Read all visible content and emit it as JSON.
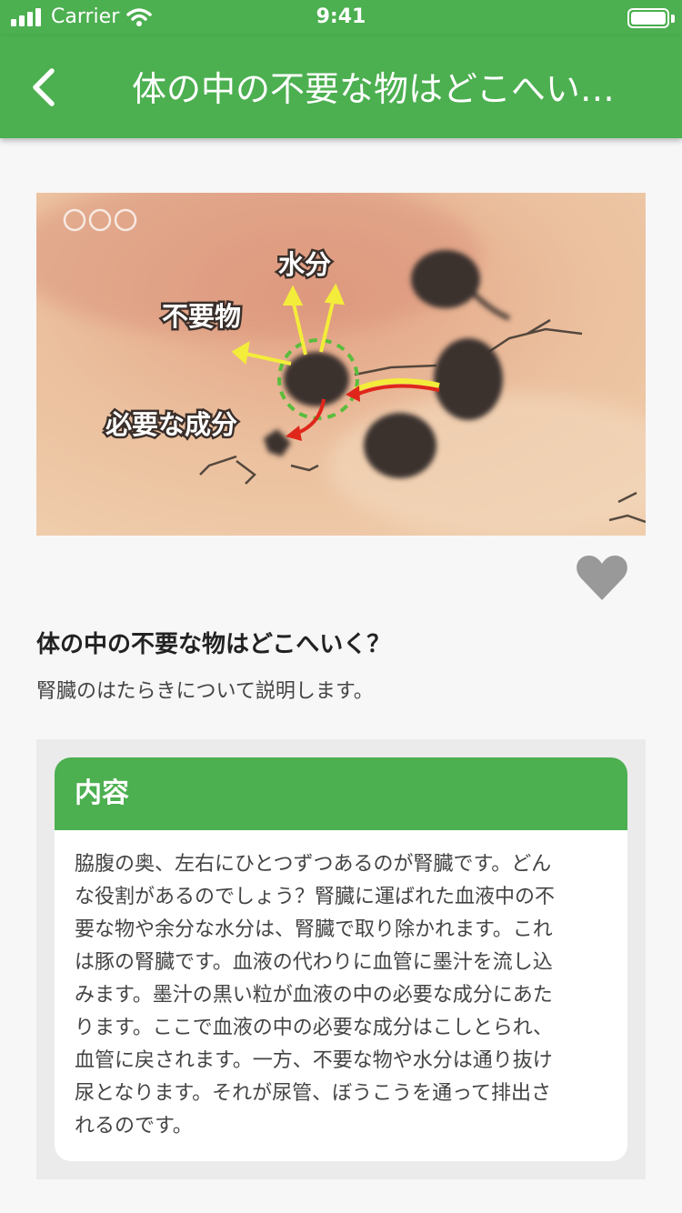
{
  "status_bar": {
    "carrier": "Carrier",
    "time": "9:41"
  },
  "nav": {
    "title": "体の中の不要な物はどこへい…",
    "back_icon": "chevron-left-icon"
  },
  "hero": {
    "labels": {
      "water": "水分",
      "waste": "不要物",
      "needed": "必要な成分"
    }
  },
  "favorite_icon": "heart-icon",
  "item": {
    "title": "体の中の不要な物はどこへいく？",
    "subtitle": "腎臓のはたらきについて説明します。"
  },
  "content": {
    "header": "内容",
    "lines": [
      "脇腹の奥、左右にひとつずつあるのが腎臓です。どん",
      "な役割があるのでしょう？腎臓に運ばれた血液中の不",
      "要な物や余分な水分は、腎臓で取り除かれます。これ",
      "は豚の腎臓です。血液の代わりに血管に墨汁を流し込",
      "みます。墨汁の黒い粒が血液の中の必要な成分にあた",
      "ります。ここで血液の中の必要な成分はこしとられ、",
      "血管に戻されます。一方、不要な物や水分は通り抜け",
      "尿となります。それが尿管、ぼうこうを通って排出さ",
      "れるのです。"
    ]
  },
  "colors": {
    "brand_green": "#4caf50",
    "heart_gray": "#999999"
  }
}
